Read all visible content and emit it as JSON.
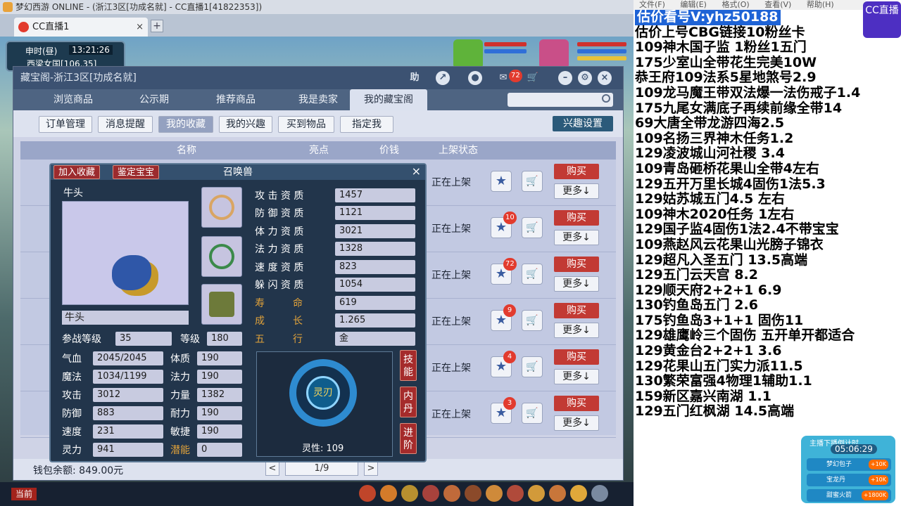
{
  "titlebar": {
    "text": "梦幻西游 ONLINE - (浙江3区[功成名就] - CC直播1[41822353])"
  },
  "browser_tab": {
    "label": "CC直播1",
    "close": "×",
    "new_tab": "+"
  },
  "clock": {
    "period": "申时(昼)",
    "time": "13:21:26",
    "location": "西梁女国[106,35]"
  },
  "window": {
    "title": "藏宝阁-浙江3区[功成名就]",
    "help": "助",
    "cart_count": "72"
  },
  "nav_tabs": [
    {
      "label": "浏览商品"
    },
    {
      "label": "公示期"
    },
    {
      "label": "推荐商品"
    },
    {
      "label": "我是卖家"
    },
    {
      "label": "我的藏宝阁"
    }
  ],
  "sub_tabs": [
    {
      "label": "订单管理"
    },
    {
      "label": "消息提醒"
    },
    {
      "label": "我的收藏"
    },
    {
      "label": "我的兴趣"
    },
    {
      "label": "买到物品"
    },
    {
      "label": "指定我"
    }
  ],
  "interest_button": "兴趣设置",
  "columns": {
    "name": "名称",
    "highlight": "亮点",
    "price": "价钱",
    "status": "上架状态"
  },
  "rows": [
    {
      "status": "正在上架",
      "badge": "",
      "buy": "购买",
      "more": "更多↓"
    },
    {
      "status": "正在上架",
      "badge": "10",
      "buy": "购买",
      "more": "更多↓"
    },
    {
      "status": "正在上架",
      "badge": "72",
      "buy": "购买",
      "more": "更多↓"
    },
    {
      "status": "正在上架",
      "badge": "9",
      "buy": "购买",
      "more": "更多↓"
    },
    {
      "status": "正在上架",
      "badge": "4",
      "buy": "购买",
      "more": "更多↓"
    },
    {
      "status": "正在上架",
      "badge": "3",
      "buy": "购买",
      "more": "更多↓"
    }
  ],
  "wallet": "钱包余额: 849.00元",
  "pager": {
    "prev": "<",
    "page": "1/9",
    "next": ">"
  },
  "popup": {
    "title": "召唤兽",
    "add_fav": "加入收藏",
    "identify": "鉴定宝宝",
    "close": "×",
    "pet_name": "牛头",
    "pet_name_field": "牛头",
    "level_label": "参战等级",
    "level_value": "35",
    "grade_label": "等级",
    "grade_value": "180",
    "stats_left": [
      {
        "label": "气血",
        "value": "2045/2045"
      },
      {
        "label": "魔法",
        "value": "1034/1199"
      },
      {
        "label": "攻击",
        "value": "3012"
      },
      {
        "label": "防御",
        "value": "883"
      },
      {
        "label": "速度",
        "value": "231"
      },
      {
        "label": "灵力",
        "value": "941"
      }
    ],
    "stats_mid": [
      {
        "label": "体质",
        "value": "190"
      },
      {
        "label": "法力",
        "value": "190"
      },
      {
        "label": "力量",
        "value": "1382"
      },
      {
        "label": "耐力",
        "value": "190"
      },
      {
        "label": "敏捷",
        "value": "190"
      },
      {
        "label": "潜能",
        "value": "0"
      }
    ],
    "aptitudes": [
      {
        "label": "攻 击 资 质",
        "value": "1457"
      },
      {
        "label": "防 御 资 质",
        "value": "1121"
      },
      {
        "label": "体 力 资 质",
        "value": "3021"
      },
      {
        "label": "法 力 资 质",
        "value": "1328"
      },
      {
        "label": "速 度 资 质",
        "value": "823"
      },
      {
        "label": "躲 闪 资 质",
        "value": "1054"
      },
      {
        "label": "寿         命",
        "value": "619"
      },
      {
        "label": "成         长",
        "value": "1.265"
      },
      {
        "label": "五         行",
        "value": "金"
      }
    ],
    "skill_ring": "灵刃",
    "linxing": "灵性: 109",
    "side_tabs": [
      "技能",
      "内丹",
      "进阶"
    ]
  },
  "right_menu": [
    "文件(F)",
    "编辑(E)",
    "格式(O)",
    "查看(V)",
    "帮助(H)"
  ],
  "cc_logo": "CC直播",
  "right_lines": [
    "估价看号V:yhz50188",
    "估价上号CBG链接10粉丝卡",
    "109神木国子监  1粉丝1五门",
    "175少室山全带花生完美10W",
    "恭王府109法系5星地煞号2.9",
    "109龙马魔王带双法爆一法伤戒子1.4",
    "175九尾女满底子再续前缘全带14",
    "69大唐全带龙游四海2.5",
    "109名扬三界神木任务1.2",
    "129凌波城山河社稷   3.4",
    "109青岛砸桥花果山全带4左右",
    "129五开万里长城4固伤1法5.3",
    "129姑苏城五门4.5  左右",
    "109神木2020任务   1左右",
    "129国子监4固伤1法2.4不带宝宝",
    "109燕赵风云花果山光膀子锦衣",
    "129超凡入圣五门   13.5高端",
    "129五门云天宫  8.2",
    "129顺天府2+2+1   6.9",
    "130钓鱼岛五门   2.6",
    "175钓鱼岛3+1+1  固伤11",
    "129雄鹰岭三个固伤  五开单开都适合",
    "129黄金台2+2+1  3.6",
    "129花果山五门实力派11.5",
    "130繁荣富强4物理1辅助1.1",
    "159新区嘉兴南湖   1.1",
    "129五门红枫湖  14.5高端"
  ],
  "live_box": {
    "title": "主播下播倒计时",
    "time": "05:06:29",
    "items": [
      {
        "label": "梦幻包子",
        "price": "+10K"
      },
      {
        "label": "宝龙丹",
        "price": "+10K"
      },
      {
        "label": "甜蜜火箭",
        "price": "+1800K"
      }
    ]
  },
  "bottom": {
    "current_label": "当前"
  },
  "colors": {
    "nav_bg": "#4e6482",
    "buy_red": "#c23a34",
    "highlight_blue": "#1e63d6",
    "gold": "#e1a23a"
  }
}
